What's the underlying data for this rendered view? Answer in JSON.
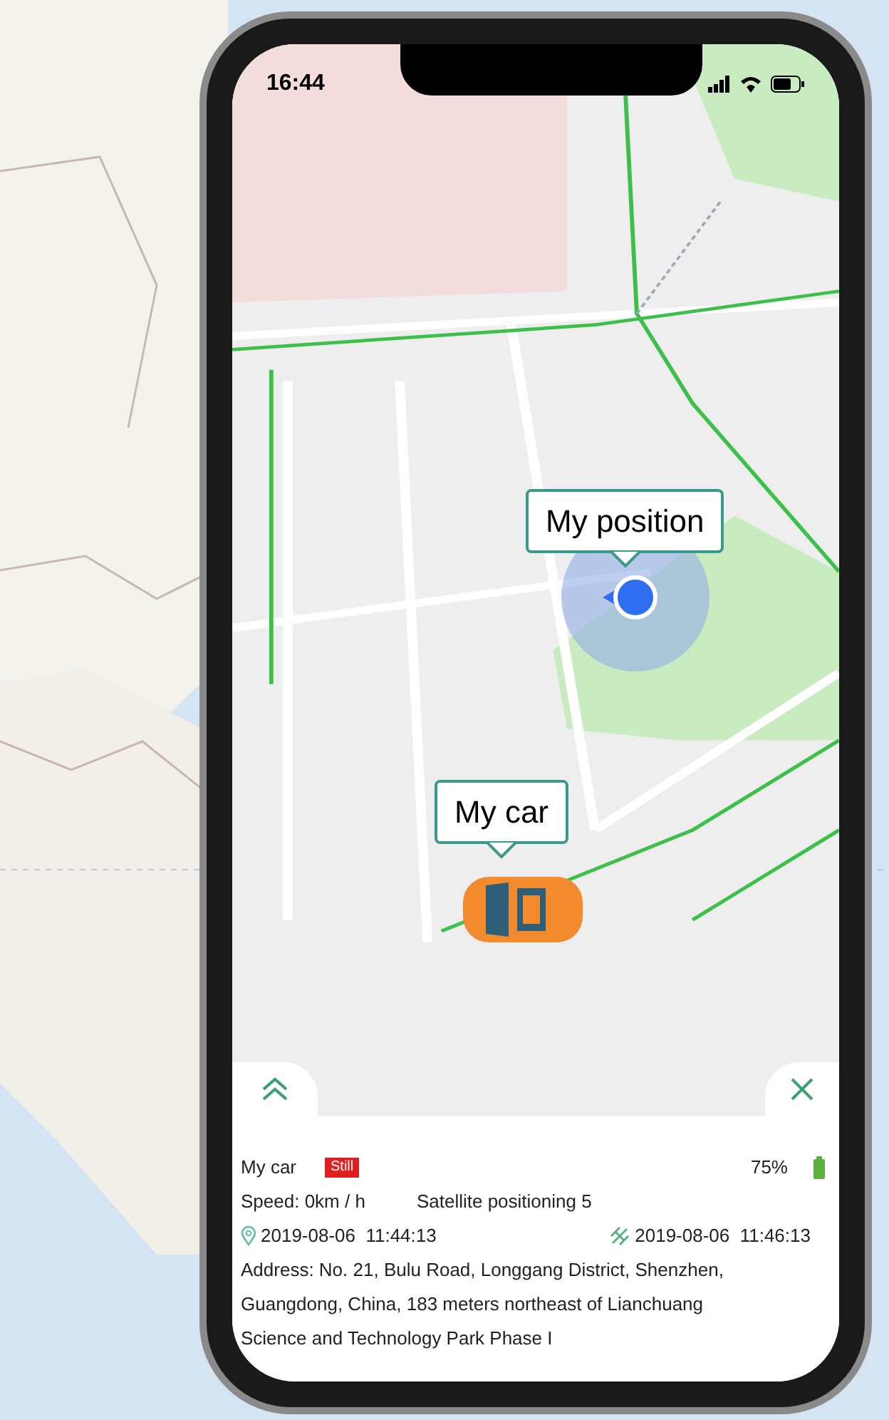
{
  "status_bar": {
    "time": "16:44"
  },
  "markers": [
    {
      "kind": "position",
      "label": "My position"
    },
    {
      "kind": "car",
      "label": "My car"
    }
  ],
  "panel": {
    "name": "My car",
    "status": "Still",
    "battery": "75%",
    "speed": "Speed: 0km / h",
    "satellites": "Satellite positioning 5",
    "position_time": "2019-08-06  11:44:13",
    "signal_time": "2019-08-06  11:46:13",
    "address": "Address: No. 21, Bulu Road, Longgang District, Shenzhen, Guangdong, China, 183 meters northeast of Lianchuang Science and Technology Park Phase I"
  }
}
